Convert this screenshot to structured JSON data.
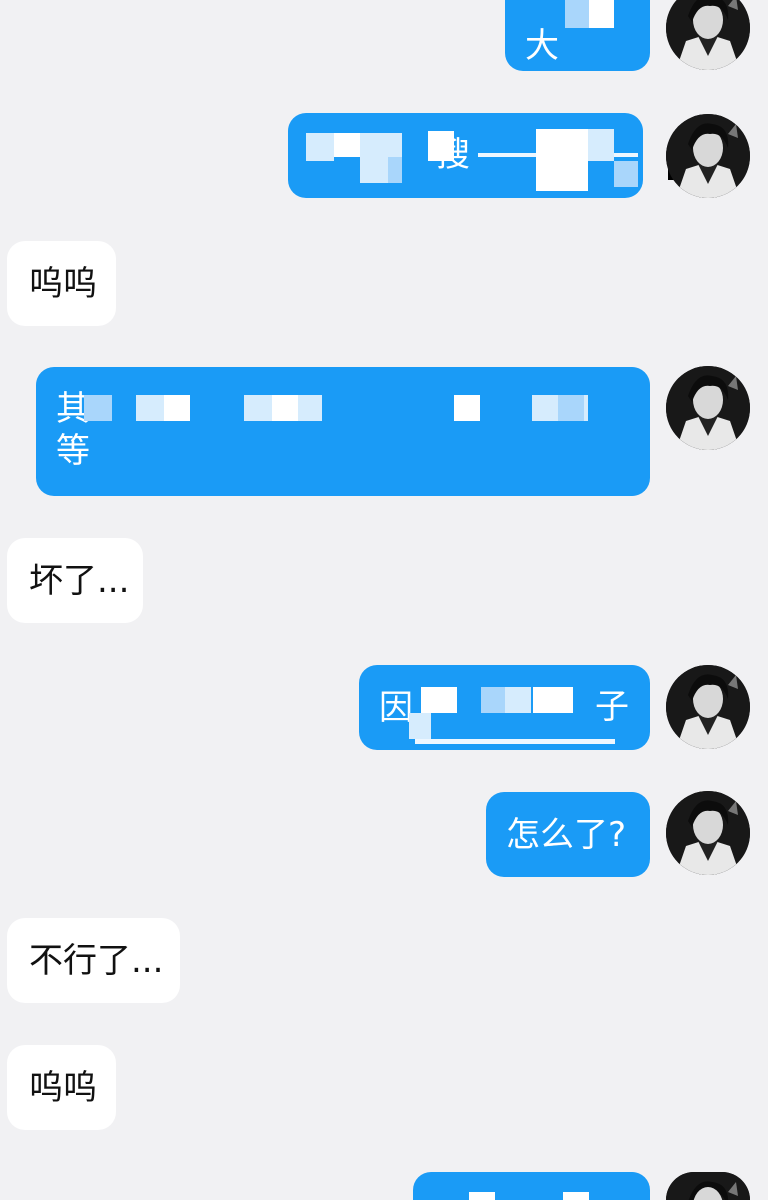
{
  "messages": [
    {
      "side": "out",
      "text": "大",
      "redacted": true
    },
    {
      "side": "out",
      "text": "搜",
      "redacted": true
    },
    {
      "side": "in",
      "text": "呜呜"
    },
    {
      "side": "out",
      "text": "其",
      "text_line2": "等",
      "redacted": true
    },
    {
      "side": "in",
      "text": "坏了..."
    },
    {
      "side": "out",
      "text": "因",
      "text_tail": "子",
      "redacted": true
    },
    {
      "side": "out",
      "text": "怎么了?"
    },
    {
      "side": "in",
      "text": "不行了..."
    },
    {
      "side": "in",
      "text": "呜呜"
    },
    {
      "side": "out",
      "text": "",
      "redacted": true
    }
  ],
  "colors": {
    "background": "#f1f1f3",
    "outgoing_bubble": "#1a9bf6",
    "incoming_bubble": "#ffffff",
    "outgoing_text": "#ffffff",
    "incoming_text": "#111111"
  },
  "avatar_icon": "anime-character-avatar-icon"
}
